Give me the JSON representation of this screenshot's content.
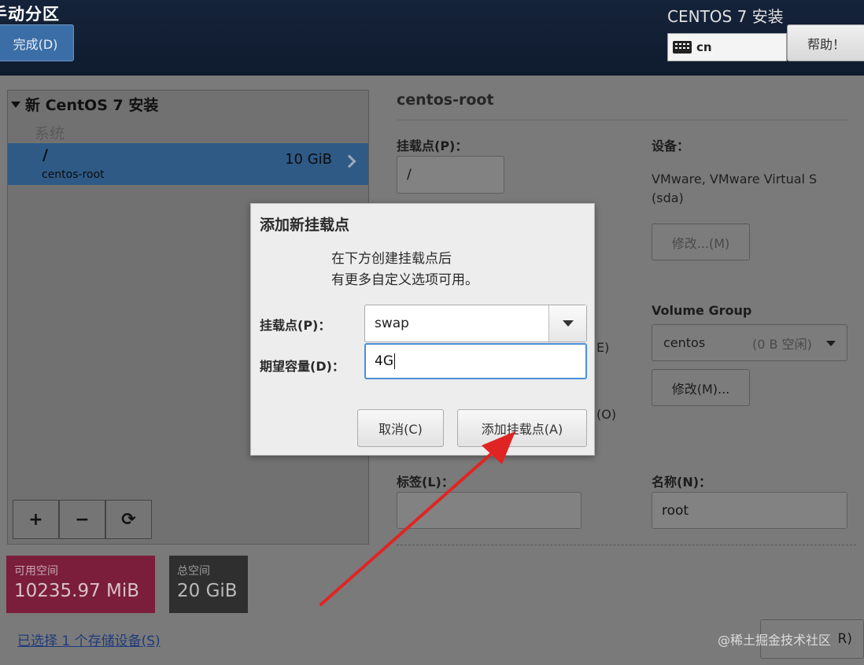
{
  "header": {
    "title": "手动分区",
    "done_label": "完成(D)",
    "product_title": "CENTOS 7 安装",
    "keyboard_layout": "cn",
    "help_label": "帮助！"
  },
  "left": {
    "tree_title": "新 CentOS 7 安装",
    "section": "系统",
    "partition": {
      "mount": "/",
      "name": "centos-root",
      "size": "10 GiB"
    },
    "tools": {
      "add": "+",
      "remove": "−",
      "refresh": "⟳"
    },
    "available_label": "可用空间",
    "available_value": "10235.97 MiB",
    "total_label": "总空间",
    "total_value": "20 GiB",
    "storage_link": "已选择 1 个存储设备(S)"
  },
  "right": {
    "title": "centos-root",
    "mount_label": "挂载点(P)：",
    "mount_value": "/",
    "device_label": "设备：",
    "device_value_line1": "VMware, VMware Virtual S",
    "device_value_line2": "(sda)",
    "modify1_label": "修改...(M)",
    "vg_label": "Volume Group",
    "vg_name": "centos",
    "vg_free": "(0 B 空闲)",
    "modify2_label": "修改(M)...",
    "partial_e": "E)",
    "partial_o": "(O)",
    "label_label": "标签(L)：",
    "label_value": "",
    "name_label": "名称(N)：",
    "name_value": "root",
    "finish_partial": "R)"
  },
  "dialog": {
    "title": "添加新挂载点",
    "desc_line1": "在下方创建挂载点后",
    "desc_line2": "有更多自定义选项可用。",
    "mount_label": "挂载点(P)：",
    "mount_value": "swap",
    "capacity_label": "期望容量(D)：",
    "capacity_value": "4G",
    "cancel_label": "取消(C)",
    "add_label": "添加挂载点(A)"
  },
  "annotation": {
    "arrow_color": "#e02424"
  },
  "watermark": "@稀土掘金技术社区"
}
